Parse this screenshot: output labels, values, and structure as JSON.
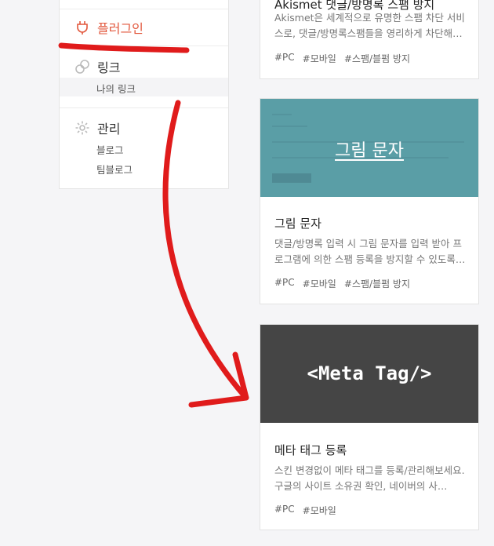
{
  "sidebar": {
    "plugin": {
      "label": "플러그인",
      "icon": "plug-icon"
    },
    "link": {
      "label": "링크",
      "icon": "link-icon",
      "sub": [
        "나의 링크"
      ]
    },
    "manage": {
      "label": "관리",
      "icon": "gear-icon",
      "sub": [
        "블로그",
        "팀블로그"
      ]
    }
  },
  "cards": [
    {
      "title": "Akismet 댓글/방명록 스팸 방지",
      "desc": "Akismet은 세계적으로 유명한 스팸 차단 서비스로, 댓글/방명록스팸들을 영리하게 차단해…",
      "tags": [
        "#PC",
        "#모바일",
        "#스팸/블펌 방지"
      ]
    },
    {
      "thumb_text": "그림 문자",
      "title": "그림 문자",
      "desc": "댓글/방명록 입력 시 그림 문자를 입력 받아 프로그램에 의한 스팸 등록을 방지할 수 있도록…",
      "tags": [
        "#PC",
        "#모바일",
        "#스팸/블펌 방지"
      ]
    },
    {
      "thumb_text": "<Meta Tag/>",
      "title": "메타 태그 등록",
      "desc": "스킨 변경없이 메타 태그를 등록/관리해보세요. 구글의 사이트 소유권 확인, 네이버의 사…",
      "tags": [
        "#PC",
        "#모바일"
      ]
    }
  ],
  "colors": {
    "accent": "#e2563b",
    "annotation": "#e01b1b",
    "teal_thumb": "#5a9ea6",
    "dark_thumb": "#454545"
  }
}
